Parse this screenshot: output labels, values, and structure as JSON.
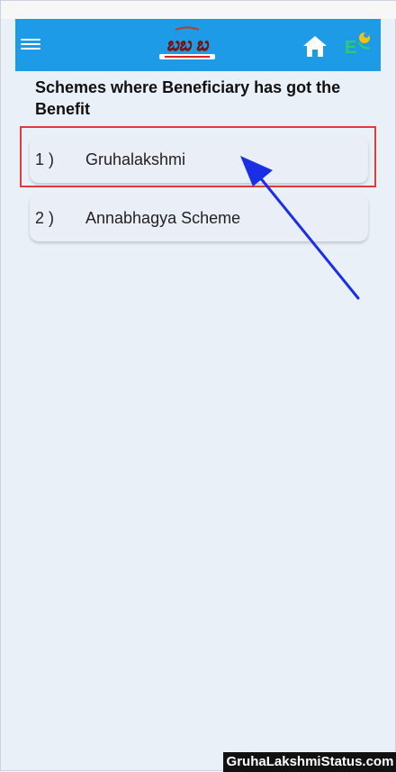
{
  "header": {
    "logo_icon": "gruha-lakshmi-logo",
    "menu_icon": "hamburger-menu-icon",
    "home_icon": "home-icon",
    "language_icon": "language-icon",
    "color": "#1e9be6"
  },
  "main": {
    "title": "Schemes where Beneficiary has got the Benefit",
    "schemes": [
      {
        "number": "1 )",
        "name": "Gruhalakshmi",
        "highlighted": true
      },
      {
        "number": "2 )",
        "name": "Annabhagya Scheme",
        "highlighted": false
      }
    ]
  },
  "annotations": {
    "highlight_color": "#e23b3b",
    "arrow_color": "#1a2ee6"
  },
  "watermark": {
    "text": "GruhaLakshmiStatus.com"
  }
}
